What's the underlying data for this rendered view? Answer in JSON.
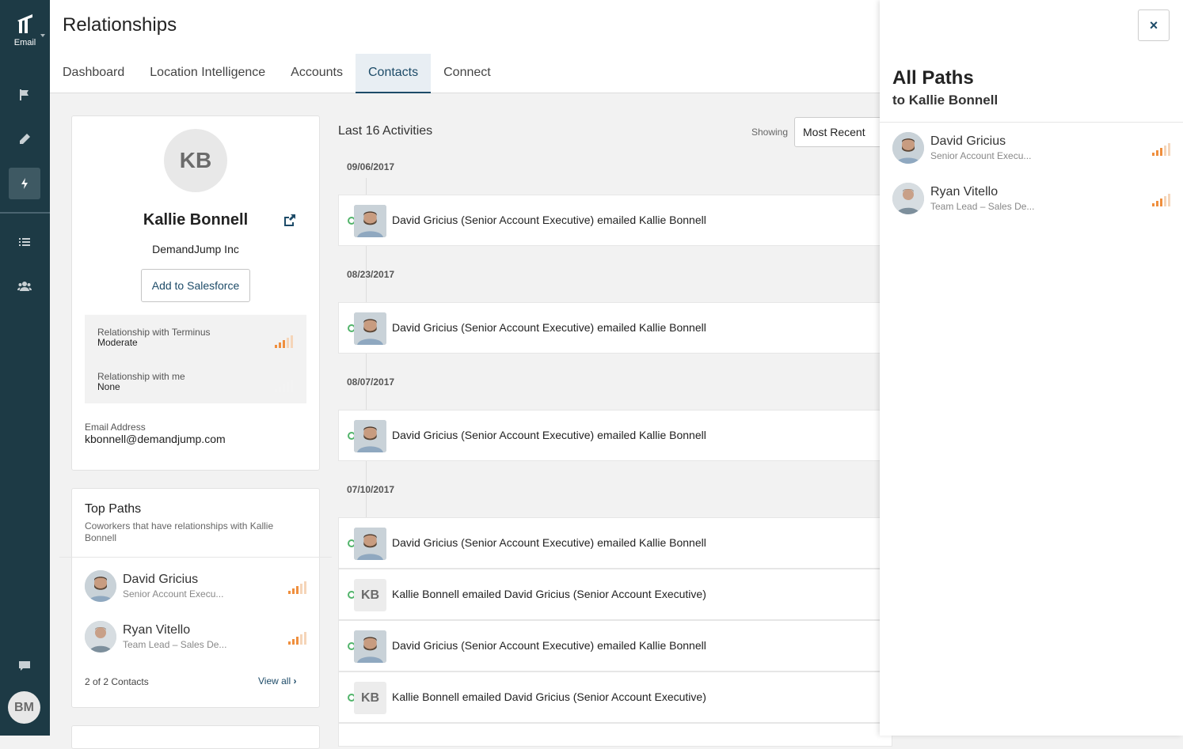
{
  "sidebar": {
    "logo_label": "Email",
    "user_initials": "BM",
    "icons": [
      "flag-icon",
      "pencil-icon",
      "bolt-icon",
      "list-icon",
      "users-icon",
      "chat-icon"
    ]
  },
  "header": {
    "title": "Relationships",
    "tabs": [
      {
        "label": "Dashboard"
      },
      {
        "label": "Location Intelligence"
      },
      {
        "label": "Accounts"
      },
      {
        "label": "Contacts",
        "active": true
      },
      {
        "label": "Connect"
      }
    ]
  },
  "contact": {
    "initials": "KB",
    "name": "Kallie Bonnell",
    "company": "DemandJump Inc",
    "add_button": "Add to Salesforce",
    "relationships": [
      {
        "label": "Relationship with Terminus",
        "value": "Moderate",
        "strength": 3
      },
      {
        "label": "Relationship with me",
        "value": "None",
        "strength": 0
      }
    ],
    "email_label": "Email Address",
    "email": "kbonnell@demandjump.com"
  },
  "top_paths": {
    "title": "Top Paths",
    "subtitle": "Coworkers that have relationships with Kallie Bonnell",
    "people": [
      {
        "name": "David Gricius",
        "role": "Senior Account Execu...",
        "strength": 3
      },
      {
        "name": "Ryan Vitello",
        "role": "Team Lead – Sales De...",
        "strength": 3
      }
    ],
    "count": "2 of 2 Contacts",
    "view_all": "View all"
  },
  "activities": {
    "title": "Last 16 Activities",
    "showing_label": "Showing",
    "sort": "Most Recent",
    "dates": [
      "09/06/2017",
      "08/23/2017",
      "08/07/2017",
      "07/10/2017"
    ],
    "rows": [
      {
        "text": "David Gricius (Senior Account Executive) emailed Kallie Bonnell",
        "avatar": "photo"
      },
      {
        "text": "David Gricius (Senior Account Executive) emailed Kallie Bonnell",
        "avatar": "photo"
      },
      {
        "text": "David Gricius (Senior Account Executive) emailed Kallie Bonnell",
        "avatar": "photo"
      },
      {
        "text": "David Gricius (Senior Account Executive) emailed Kallie Bonnell",
        "avatar": "photo"
      },
      {
        "text": "Kallie Bonnell emailed David Gricius (Senior Account Executive)",
        "avatar": "KB"
      },
      {
        "text": "David Gricius (Senior Account Executive) emailed Kallie Bonnell",
        "avatar": "photo"
      },
      {
        "text": "Kallie Bonnell emailed David Gricius (Senior Account Executive)",
        "avatar": "KB"
      }
    ]
  },
  "panel": {
    "close": "×",
    "title": "All Paths",
    "subtitle": "to Kallie Bonnell",
    "people": [
      {
        "name": "David Gricius",
        "role": "Senior Account Execu...",
        "strength": 3
      },
      {
        "name": "Ryan Vitello",
        "role": "Team Lead – Sales De...",
        "strength": 3
      }
    ]
  },
  "colors": {
    "sidebar": "#1d3a45",
    "accent": "#1d4b68",
    "signal": "#ef8f3e",
    "activity_dot": "#52b46b"
  }
}
